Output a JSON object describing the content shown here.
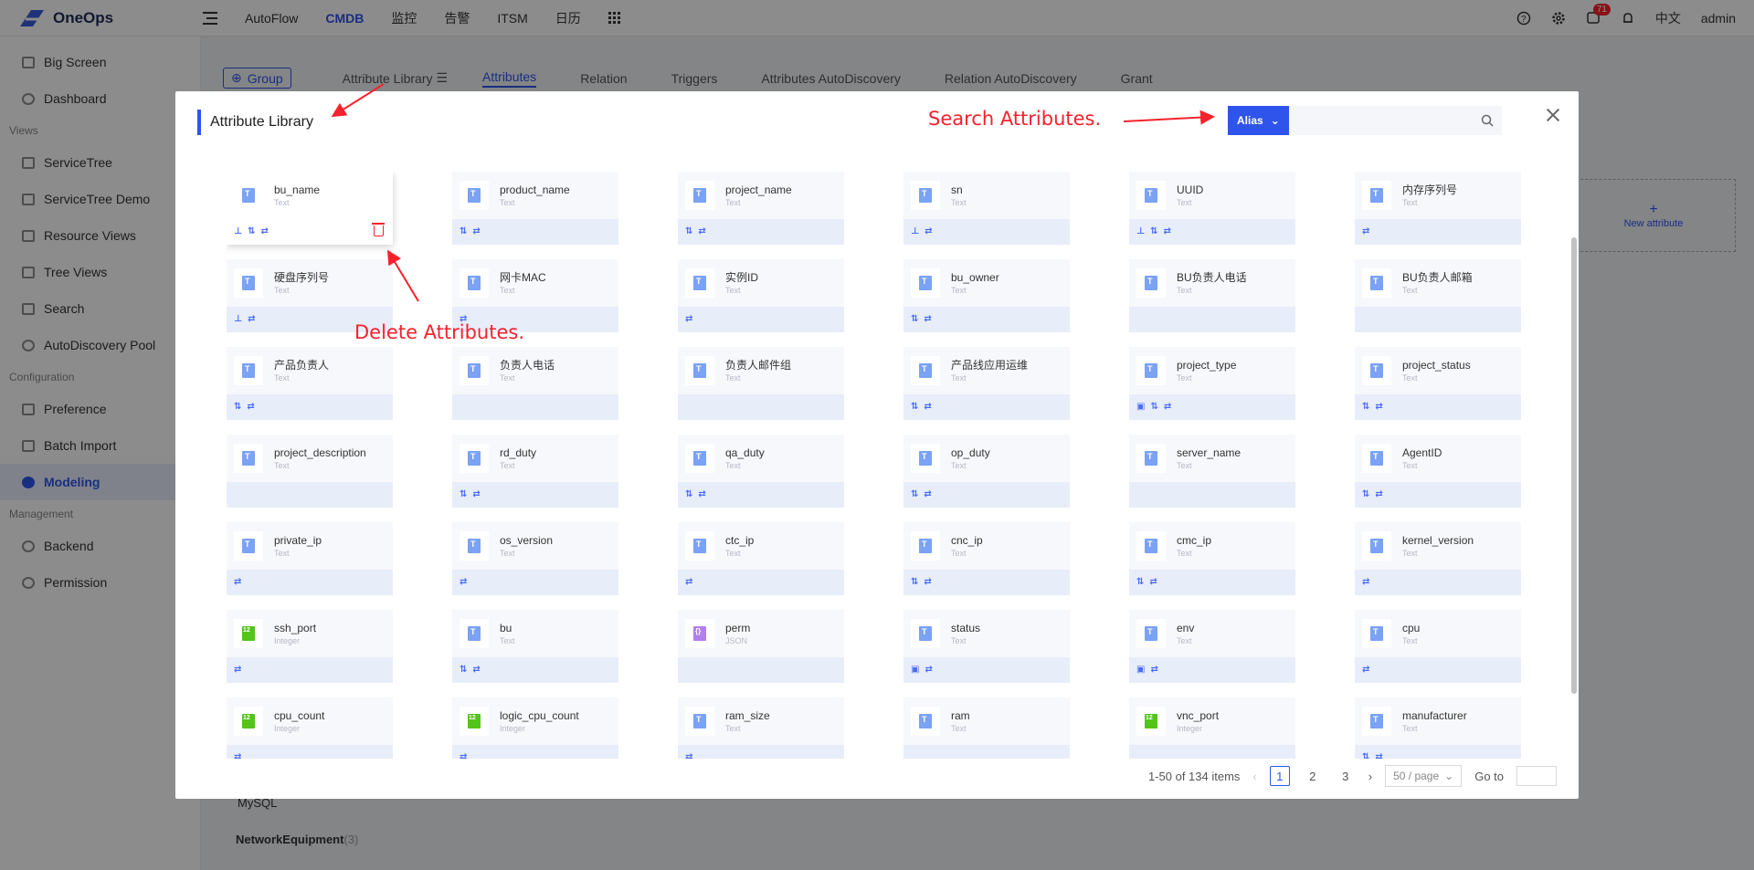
{
  "app": {
    "title": "OneOps"
  },
  "topnav": {
    "items": [
      "AutoFlow",
      "CMDB",
      "监控",
      "告警",
      "ITSM",
      "日历"
    ],
    "active": "CMDB"
  },
  "topright": {
    "badge": "71",
    "lang": "中文",
    "user": "admin"
  },
  "sidebar": {
    "items": [
      "Big Screen",
      "Dashboard",
      "ServiceTree",
      "ServiceTree Demo",
      "Resource Views",
      "Tree Views",
      "Search",
      "AutoDiscovery Pool",
      "Preference",
      "Batch Import",
      "Modeling",
      "Backend",
      "Permission"
    ],
    "groups": [
      "Views",
      "Configuration",
      "Management"
    ],
    "active": "Modeling"
  },
  "background": {
    "group_btn": "Group",
    "lib_label": "Attribute Library",
    "tabs": [
      "Attributes",
      "Relation",
      "Triggers",
      "Attributes AutoDiscovery",
      "Relation AutoDiscovery",
      "Grant"
    ],
    "new_attr": "New attribute",
    "tree_item": "MySQL",
    "tree_group": "NetworkEquipment",
    "tree_count": "(3)"
  },
  "modal": {
    "title": "Attribute Library",
    "search_select": "Alias",
    "search_placeholder": "",
    "cards": [
      {
        "name": "bu_name",
        "type": "Text",
        "icon": "text",
        "flags": [
          "pin",
          "sort",
          "swap"
        ]
      },
      {
        "name": "product_name",
        "type": "Text",
        "icon": "text",
        "flags": [
          "sort",
          "swap"
        ]
      },
      {
        "name": "project_name",
        "type": "Text",
        "icon": "text",
        "flags": [
          "sort",
          "swap"
        ]
      },
      {
        "name": "sn",
        "type": "Text",
        "icon": "text",
        "flags": [
          "pin",
          "swap"
        ]
      },
      {
        "name": "UUID",
        "type": "Text",
        "icon": "text",
        "flags": [
          "pin",
          "sort",
          "swap"
        ]
      },
      {
        "name": "内存序列号",
        "type": "Text",
        "icon": "text",
        "flags": [
          "swap"
        ]
      },
      {
        "name": "硬盘序列号",
        "type": "Text",
        "icon": "text",
        "flags": [
          "pin",
          "swap"
        ]
      },
      {
        "name": "网卡MAC",
        "type": "Text",
        "icon": "text",
        "flags": [
          "swap"
        ]
      },
      {
        "name": "实例ID",
        "type": "Text",
        "icon": "text",
        "flags": [
          "swap"
        ]
      },
      {
        "name": "bu_owner",
        "type": "Text",
        "icon": "text",
        "flags": [
          "sort",
          "swap"
        ]
      },
      {
        "name": "BU负责人电话",
        "type": "Text",
        "icon": "text",
        "flags": []
      },
      {
        "name": "BU负责人邮箱",
        "type": "Text",
        "icon": "text",
        "flags": []
      },
      {
        "name": "产品负责人",
        "type": "Text",
        "icon": "text",
        "flags": [
          "sort",
          "swap"
        ]
      },
      {
        "name": "负责人电话",
        "type": "Text",
        "icon": "text",
        "flags": []
      },
      {
        "name": "负责人邮件组",
        "type": "Text",
        "icon": "text",
        "flags": []
      },
      {
        "name": "产品线应用运维",
        "type": "Text",
        "icon": "text",
        "flags": [
          "sort",
          "swap"
        ]
      },
      {
        "name": "project_type",
        "type": "Text",
        "icon": "text",
        "flags": [
          "box",
          "sort",
          "swap"
        ]
      },
      {
        "name": "project_status",
        "type": "Text",
        "icon": "text",
        "flags": [
          "sort",
          "swap"
        ]
      },
      {
        "name": "project_description",
        "type": "Text",
        "icon": "text",
        "flags": []
      },
      {
        "name": "rd_duty",
        "type": "Text",
        "icon": "text",
        "flags": [
          "sort",
          "swap"
        ]
      },
      {
        "name": "qa_duty",
        "type": "Text",
        "icon": "text",
        "flags": [
          "sort",
          "swap"
        ]
      },
      {
        "name": "op_duty",
        "type": "Text",
        "icon": "text",
        "flags": [
          "sort",
          "swap"
        ]
      },
      {
        "name": "server_name",
        "type": "Text",
        "icon": "text",
        "flags": []
      },
      {
        "name": "AgentID",
        "type": "Text",
        "icon": "text",
        "flags": [
          "sort",
          "swap"
        ]
      },
      {
        "name": "private_ip",
        "type": "Text",
        "icon": "text",
        "flags": [
          "swap"
        ]
      },
      {
        "name": "os_version",
        "type": "Text",
        "icon": "text",
        "flags": [
          "swap"
        ]
      },
      {
        "name": "ctc_ip",
        "type": "Text",
        "icon": "text",
        "flags": [
          "swap"
        ]
      },
      {
        "name": "cnc_ip",
        "type": "Text",
        "icon": "text",
        "flags": [
          "sort",
          "swap"
        ]
      },
      {
        "name": "cmc_ip",
        "type": "Text",
        "icon": "text",
        "flags": [
          "sort",
          "swap"
        ]
      },
      {
        "name": "kernel_version",
        "type": "Text",
        "icon": "text",
        "flags": [
          "swap"
        ]
      },
      {
        "name": "ssh_port",
        "type": "Integer",
        "icon": "integer",
        "flags": [
          "swap"
        ]
      },
      {
        "name": "bu",
        "type": "Text",
        "icon": "text",
        "flags": [
          "sort",
          "swap"
        ]
      },
      {
        "name": "perm",
        "type": "JSON",
        "icon": "json",
        "flags": []
      },
      {
        "name": "status",
        "type": "Text",
        "icon": "text",
        "flags": [
          "box",
          "swap"
        ]
      },
      {
        "name": "env",
        "type": "Text",
        "icon": "text",
        "flags": [
          "box",
          "swap"
        ]
      },
      {
        "name": "cpu",
        "type": "Text",
        "icon": "text",
        "flags": [
          "swap"
        ]
      },
      {
        "name": "cpu_count",
        "type": "Integer",
        "icon": "integer",
        "flags": [
          "swap"
        ]
      },
      {
        "name": "logic_cpu_count",
        "type": "Integer",
        "icon": "integer",
        "flags": [
          "swap"
        ]
      },
      {
        "name": "ram_size",
        "type": "Text",
        "icon": "text",
        "flags": [
          "swap"
        ]
      },
      {
        "name": "ram",
        "type": "Text",
        "icon": "text",
        "flags": []
      },
      {
        "name": "vnc_port",
        "type": "Integer",
        "icon": "integer",
        "flags": []
      },
      {
        "name": "manufacturer",
        "type": "Text",
        "icon": "text",
        "flags": [
          "sort",
          "swap"
        ]
      }
    ],
    "pagination": {
      "summary": "1-50 of 134 items",
      "pages": [
        "1",
        "2",
        "3"
      ],
      "current": "1",
      "page_size": "50 / page",
      "goto_label": "Go to"
    }
  },
  "annotations": {
    "search": "Search Attributes.",
    "delete": "Delete Attributes."
  },
  "colors": {
    "primary": "#2f54eb",
    "annotation": "#f5222d",
    "danger": "#f5222d"
  }
}
